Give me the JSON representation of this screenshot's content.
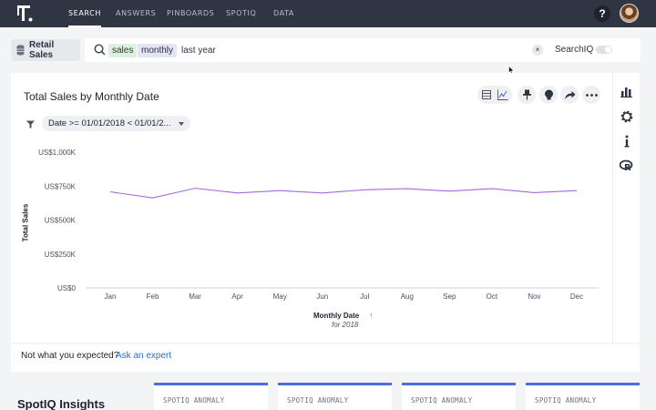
{
  "nav": {
    "tabs": [
      "SEARCH",
      "ANSWERS",
      "PINBOARDS",
      "SPOTIQ",
      "DATA"
    ],
    "active": "SEARCH",
    "help_label": "?"
  },
  "search": {
    "source": "Retail Sales",
    "tokens": [
      {
        "text": "sales",
        "kind": "measure"
      },
      {
        "text": "monthly",
        "kind": "attribute"
      },
      {
        "text": "last year",
        "kind": "keyword"
      }
    ],
    "clear_label": "×",
    "spotiq_label": "SearchIQ",
    "spotiq_enabled": false
  },
  "chart": {
    "title": "Total Sales by Monthly Date",
    "filter": "Date >= 01/01/2018 < 01/01/2...",
    "toolbar": [
      "table-icon",
      "line-chart-icon",
      "pin-icon",
      "lightbulb-icon",
      "share-icon",
      "more-icon"
    ],
    "x_axis_title": "Monthly Date",
    "x_axis_subtitle": "for 2018",
    "sort_label": "↑",
    "y_axis_title": "Total Sales"
  },
  "chart_data": {
    "type": "line",
    "categories": [
      "Jan",
      "Feb",
      "Mar",
      "Apr",
      "May",
      "Jun",
      "Jul",
      "Aug",
      "Sep",
      "Oct",
      "Nov",
      "Dec"
    ],
    "series": [
      {
        "values": [
          708000,
          663000,
          734000,
          699000,
          717000,
          699000,
          723000,
          731000,
          713000,
          731000,
          702000,
          717000
        ],
        "color": "#a46bd6"
      }
    ],
    "yticks": [
      "US$0",
      "US$250K",
      "US$500K",
      "US$750K",
      "US$1,000K"
    ],
    "ylim": [
      0,
      1000000
    ],
    "xlabel": "Monthly Date",
    "ylabel": "Total Sales",
    "grid": false,
    "legend": "none"
  },
  "rail": [
    "bar-chart-icon",
    "gear-icon",
    "info-icon",
    "r-language-icon"
  ],
  "feedback": {
    "question": "Not what you expected?",
    "link": "Ask an expert"
  },
  "insights": {
    "title": "SpotIQ Insights",
    "cards": [
      "SPOTIQ ANOMALY",
      "SPOTIQ ANOMALY",
      "SPOTIQ ANOMALY",
      "SPOTIQ ANOMALY"
    ],
    "accent": "#4a6fe3"
  }
}
